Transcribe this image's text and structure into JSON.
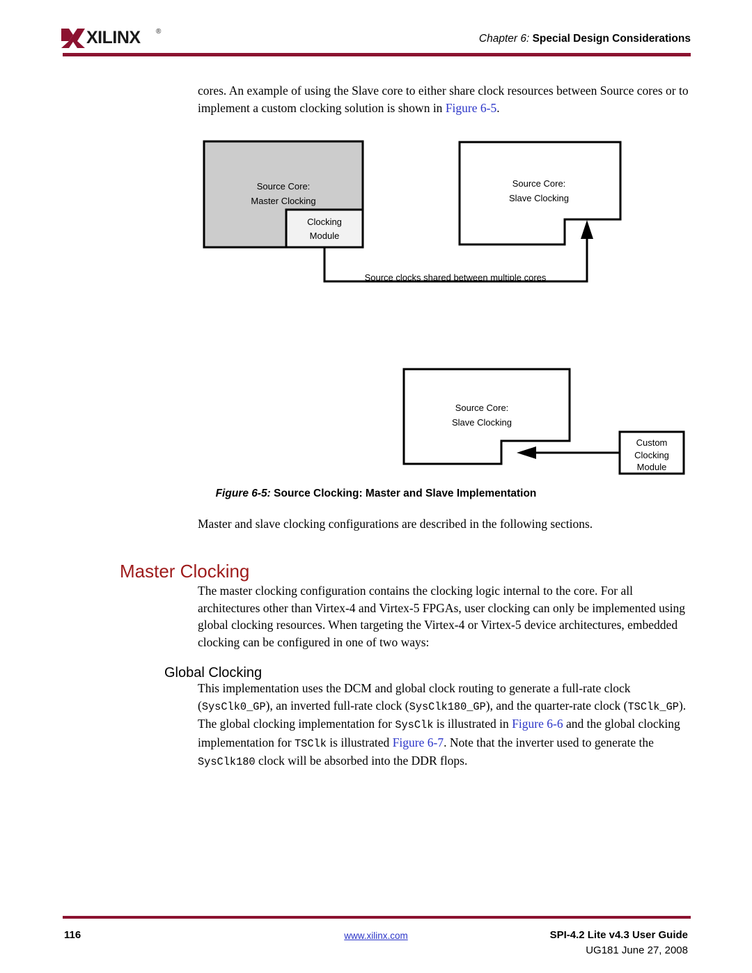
{
  "header": {
    "logo_text": "XILINX",
    "logo_registered": "®",
    "chapter_number": "Chapter 6:",
    "chapter_title": "Special Design Considerations",
    "rule_color": "#8c1230"
  },
  "body": {
    "intro_prefix": "cores. An example of using the Slave core to either share clock resources between Source cores or to implement a custom clocking solution is shown in ",
    "intro_link": "Figure 6-5",
    "intro_suffix": ".",
    "sections_para": "Master and slave clocking configurations are described in the following sections.",
    "master_heading": "Master Clocking",
    "master_heading_color": "#9e1b1b",
    "master_para": "The master clocking configuration contains the clocking logic internal to the core. For all architectures other than Virtex-4 and Virtex-5 FPGAs, user clocking can only be implemented using global clocking resources. When targeting the Virtex-4 or Virtex-5 device architectures, embedded clocking can be configured in one of two ways:",
    "global_heading": "Global Clocking",
    "global_para": {
      "t1": "This implementation uses the DCM and global clock routing to generate a full-rate clock (",
      "c1": "SysClk0_GP",
      "t2": "), an inverted full-rate clock (",
      "c2": "SysClk180_GP",
      "t3": "), and the quarter-rate clock (",
      "c3": "TSClk_GP",
      "t4": "). The global clocking implementation for ",
      "c4": "SysClk",
      "t5": " is illustrated in ",
      "l1": "Figure 6-6",
      "t6": " and the global clocking implementation for ",
      "c5": "TSClk",
      "t7": " is illustrated ",
      "l2": "Figure 6-7",
      "t8": ". Note that the inverter used to generate the ",
      "c6": "SysClk180",
      "t9": " clock will be absorbed into the DDR flops."
    }
  },
  "figure": {
    "caption_number": "Figure 6-5:",
    "caption_title": "Source Clocking: Master and Slave Implementation",
    "master_core_line1": "Source Core:",
    "master_core_line2": "Master Clocking",
    "clocking_module_line1": "Clocking",
    "clocking_module_line2": "Module",
    "slave_core_top_line1": "Source Core:",
    "slave_core_top_line2": "Slave Clocking",
    "shared_clocks_label": "Source clocks shared between multiple cores",
    "slave_core_bottom_line1": "Source Core:",
    "slave_core_bottom_line2": "Slave Clocking",
    "custom_module_line1": "Custom",
    "custom_module_line2": "Clocking",
    "custom_module_line3": "Module",
    "master_core_fill": "#cccccc",
    "module_fill": "#f2f2f2"
  },
  "footer": {
    "page_number": "116",
    "website": "www.xilinx.com",
    "guide_title": "SPI-4.2 Lite v4.3 User Guide",
    "guide_sub": "UG181 June 27, 2008"
  }
}
